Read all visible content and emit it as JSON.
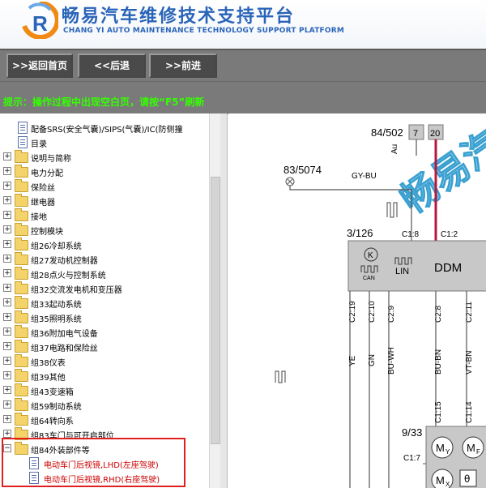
{
  "header": {
    "title_cn": "畅易汽车维修技术支持平台",
    "title_en": "CHANG YI AUTO MAINTENANCE TECHNOLOGY SUPPORT PLATFORM",
    "logo_letter": "R"
  },
  "nav": {
    "home_label": ">>返回首页",
    "back_label": "<<后退",
    "forward_label": ">>前进"
  },
  "notice": "提示：操作过程中出现空白页，请按“F5”刷新",
  "tree": {
    "items": [
      {
        "label": "配备SRS(安全气囊)/SIPS(气囊)/IC(防侧撞",
        "type": "doc"
      },
      {
        "label": "目录",
        "type": "doc"
      },
      {
        "label": "说明与简称",
        "type": "folder"
      },
      {
        "label": "电力分配",
        "type": "folder"
      },
      {
        "label": "保险丝",
        "type": "folder"
      },
      {
        "label": "继电器",
        "type": "folder"
      },
      {
        "label": "接地",
        "type": "folder"
      },
      {
        "label": "控制模块",
        "type": "folder"
      },
      {
        "label": "组26冷却系统",
        "type": "folder"
      },
      {
        "label": "组27发动机控制器",
        "type": "folder"
      },
      {
        "label": "组28点火与控制系统",
        "type": "folder"
      },
      {
        "label": "组32交流发电机和变压器",
        "type": "folder"
      },
      {
        "label": "组33起动系统",
        "type": "folder"
      },
      {
        "label": "组35照明系统",
        "type": "folder"
      },
      {
        "label": "组36附加电气设备",
        "type": "folder"
      },
      {
        "label": "组37电路和保险丝",
        "type": "folder"
      },
      {
        "label": "组38仪表",
        "type": "folder"
      },
      {
        "label": "组39其他",
        "type": "folder"
      },
      {
        "label": "组43变速箱",
        "type": "folder"
      },
      {
        "label": "组59制动系统",
        "type": "folder"
      },
      {
        "label": "组64转向系",
        "type": "folder"
      },
      {
        "label": "组83车门与可开启部位",
        "type": "folder"
      },
      {
        "label": "组84外装部件等",
        "type": "folder-open"
      },
      {
        "label": "电动车门后视镜,LHD(左座驾驶)",
        "type": "doc-red"
      },
      {
        "label": "电动车门后视镜,RHD(右座驾驶)",
        "type": "doc-red"
      }
    ]
  },
  "diagram": {
    "watermark": "畅易汽",
    "conn_top": "84/502",
    "pin_7": "7",
    "pin_20": "20",
    "au_label": "Au",
    "conn_ground": "83/5074",
    "wire_gybu": "GY-BU",
    "module_ref": "3/126",
    "c18": "C1:8",
    "c12": "C1:2",
    "can_label": "CAN",
    "lin_label": "LIN",
    "k_label": "K",
    "ddm_label": "DDM",
    "c219": "C2:19",
    "c210": "C2:10",
    "c29": "C2:9",
    "c28": "C2:8",
    "c211": "C2:11",
    "w_ye": "YE",
    "w_gn": "GN",
    "w_buwh": "BU-WH",
    "w_bubn": "BU-BN",
    "w_vtbn": "VT-BN",
    "c115": "C1:15",
    "c114": "C1:14",
    "mirror_ref": "9/33",
    "c17": "C1:7",
    "my_label": "M",
    "my_sub": "Y",
    "mf_label": "M",
    "mf_sub": "F",
    "mx_label": "M",
    "mx_sub": "X",
    "theta": "θ"
  }
}
